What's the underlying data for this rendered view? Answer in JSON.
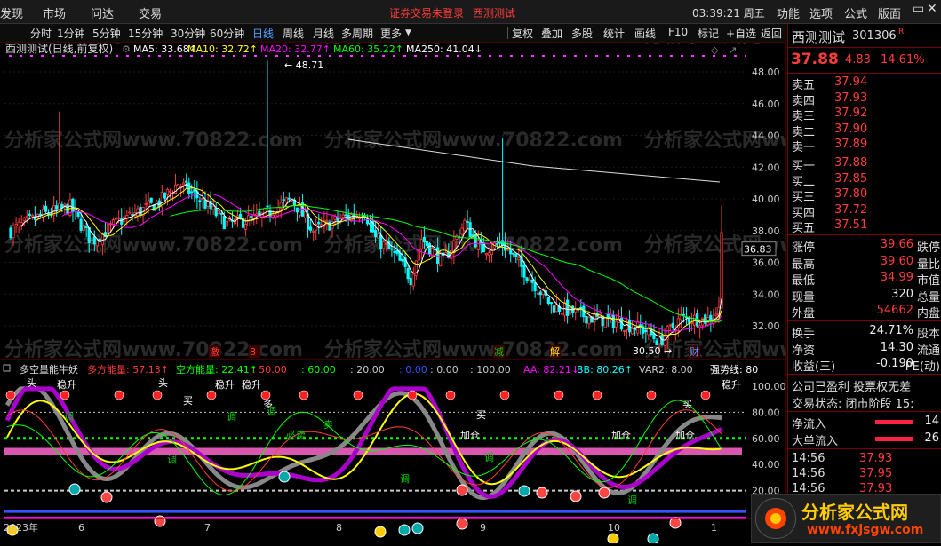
{
  "menu": {
    "items": [
      "发现",
      "市场",
      "问达",
      "交易"
    ],
    "notice_login": "证券交易未登录",
    "notice_stock": "西测测试",
    "clock": "03:39:21 周五",
    "right_items": [
      "功能",
      "选项",
      "公式",
      "版面"
    ]
  },
  "toolbar": {
    "periods": [
      "分时",
      "1分钟",
      "5分钟",
      "15分钟",
      "30分钟",
      "60分钟",
      "日线",
      "周线",
      "月线",
      "多周期",
      "更多"
    ],
    "active_period": "日线",
    "right_items": [
      "复权",
      "叠加",
      "多股",
      "统计",
      "画线",
      "F10",
      "标记",
      "+自选",
      "返回"
    ]
  },
  "main_chart": {
    "title": "西测测试(日线,前复权)",
    "ma_labels": [
      {
        "text": "MA5: 33.68↑",
        "color": "#ffffff"
      },
      {
        "text": "MA10: 32.72↑",
        "color": "#ffff00"
      },
      {
        "text": "MA20: 32.77↑",
        "color": "#ff00ff"
      },
      {
        "text": "MA60: 35.22↑",
        "color": "#00ff00"
      },
      {
        "text": "MA250: 41.04↓",
        "color": "#ffffff"
      }
    ],
    "high_label": "48.71",
    "low_label": "30.50",
    "current_price_tag": "36.83",
    "chars": [
      "激",
      "8",
      "减",
      "解",
      "财"
    ],
    "price_axis": [
      "48.00",
      "46.00",
      "44.00",
      "42.00",
      "40.00",
      "38.00",
      "36.00",
      "34.00",
      "32.00"
    ],
    "watermark": "分析家公式网www.70822.com"
  },
  "indicator": {
    "name": "多空量能牛妖",
    "labels": [
      {
        "text": "多方能量: 57.13↑",
        "color": "#ff3c3c"
      },
      {
        "text": "空方能量: 22.41↑",
        "color": "#00ff00"
      },
      {
        "text": ": 50.00",
        "color": "#ff3c3c"
      },
      {
        "text": ": 60.00",
        "color": "#00ff00"
      },
      {
        "text": ": 20.00",
        "color": "#cccccc"
      },
      {
        "text": ": 0.00",
        "color": "#3355ff"
      },
      {
        "text": ": 0.00",
        "color": "#cccccc"
      },
      {
        "text": ": 100.00",
        "color": "#cccccc"
      },
      {
        "text": "AA: 82.21↓",
        "color": "#ff00ff"
      },
      {
        "text": "BB: 80.26↑",
        "color": "#00ffff"
      },
      {
        "text": "VAR2: 8.00",
        "color": "#cccccc"
      },
      {
        "text": "强势线: 80",
        "color": "#ffffff"
      }
    ],
    "axis": [
      "100.00",
      "80.00",
      "60.00",
      "40.00",
      "20.00"
    ],
    "words": [
      "头",
      "稳升",
      "头",
      "稳升",
      "稳升",
      "买",
      "调",
      "调",
      "多",
      "卖",
      "买",
      "调",
      "加仓",
      "调",
      "加仓",
      "加仓",
      "调",
      "买",
      "稳升",
      "调",
      "调",
      "必卖"
    ]
  },
  "date_axis": [
    "2023年",
    "6",
    "7",
    "8",
    "9",
    "10",
    "1"
  ],
  "quote": {
    "name": "西测测试",
    "code": "301306",
    "code_badge": "R",
    "price": "37.88",
    "change": "4.83",
    "change_pct": "14.61%",
    "asks": [
      {
        "label": "卖五",
        "price": "37.94"
      },
      {
        "label": "卖四",
        "price": "37.93"
      },
      {
        "label": "卖三",
        "price": "37.92"
      },
      {
        "label": "卖二",
        "price": "37.90"
      },
      {
        "label": "卖一",
        "price": "37.89"
      }
    ],
    "bids": [
      {
        "label": "买一",
        "price": "37.88"
      },
      {
        "label": "买二",
        "price": "37.85"
      },
      {
        "label": "买三",
        "price": "37.80"
      },
      {
        "label": "买四",
        "price": "37.72"
      },
      {
        "label": "买五",
        "price": "37.51"
      }
    ],
    "stats": [
      {
        "l": "涨停",
        "v": "39.66",
        "c": "red",
        "r": "跌停"
      },
      {
        "l": "最高",
        "v": "39.60",
        "c": "red",
        "r": "量比"
      },
      {
        "l": "最低",
        "v": "34.99",
        "c": "red",
        "r": "市值"
      },
      {
        "l": "现量",
        "v": "320",
        "c": "white",
        "r": "总量"
      },
      {
        "l": "外盘",
        "v": "54662",
        "c": "red",
        "r": "内盘"
      }
    ],
    "stats2": [
      {
        "l": "换手",
        "v": "24.71%",
        "c": "white",
        "r": "股本"
      },
      {
        "l": "净资",
        "v": "14.30",
        "c": "white",
        "r": "流通"
      },
      {
        "l": "收益(三)",
        "v": "-0.190",
        "c": "white",
        "r": "PE(动)"
      }
    ],
    "info1": "公司已盈利 投票权无差",
    "info2": "交易状态: 闭市阶段 15:",
    "flow": [
      {
        "l": "净流入",
        "v": "14"
      },
      {
        "l": "大单流入",
        "v": "26"
      }
    ],
    "ticks": [
      {
        "t": "14:56",
        "p": "37.93"
      },
      {
        "t": "14:56",
        "p": "37.95"
      },
      {
        "t": "14:56",
        "p": "37.93"
      }
    ]
  },
  "logo": {
    "text": "分析家公式网",
    "url": "www.fxjsgw.com"
  }
}
